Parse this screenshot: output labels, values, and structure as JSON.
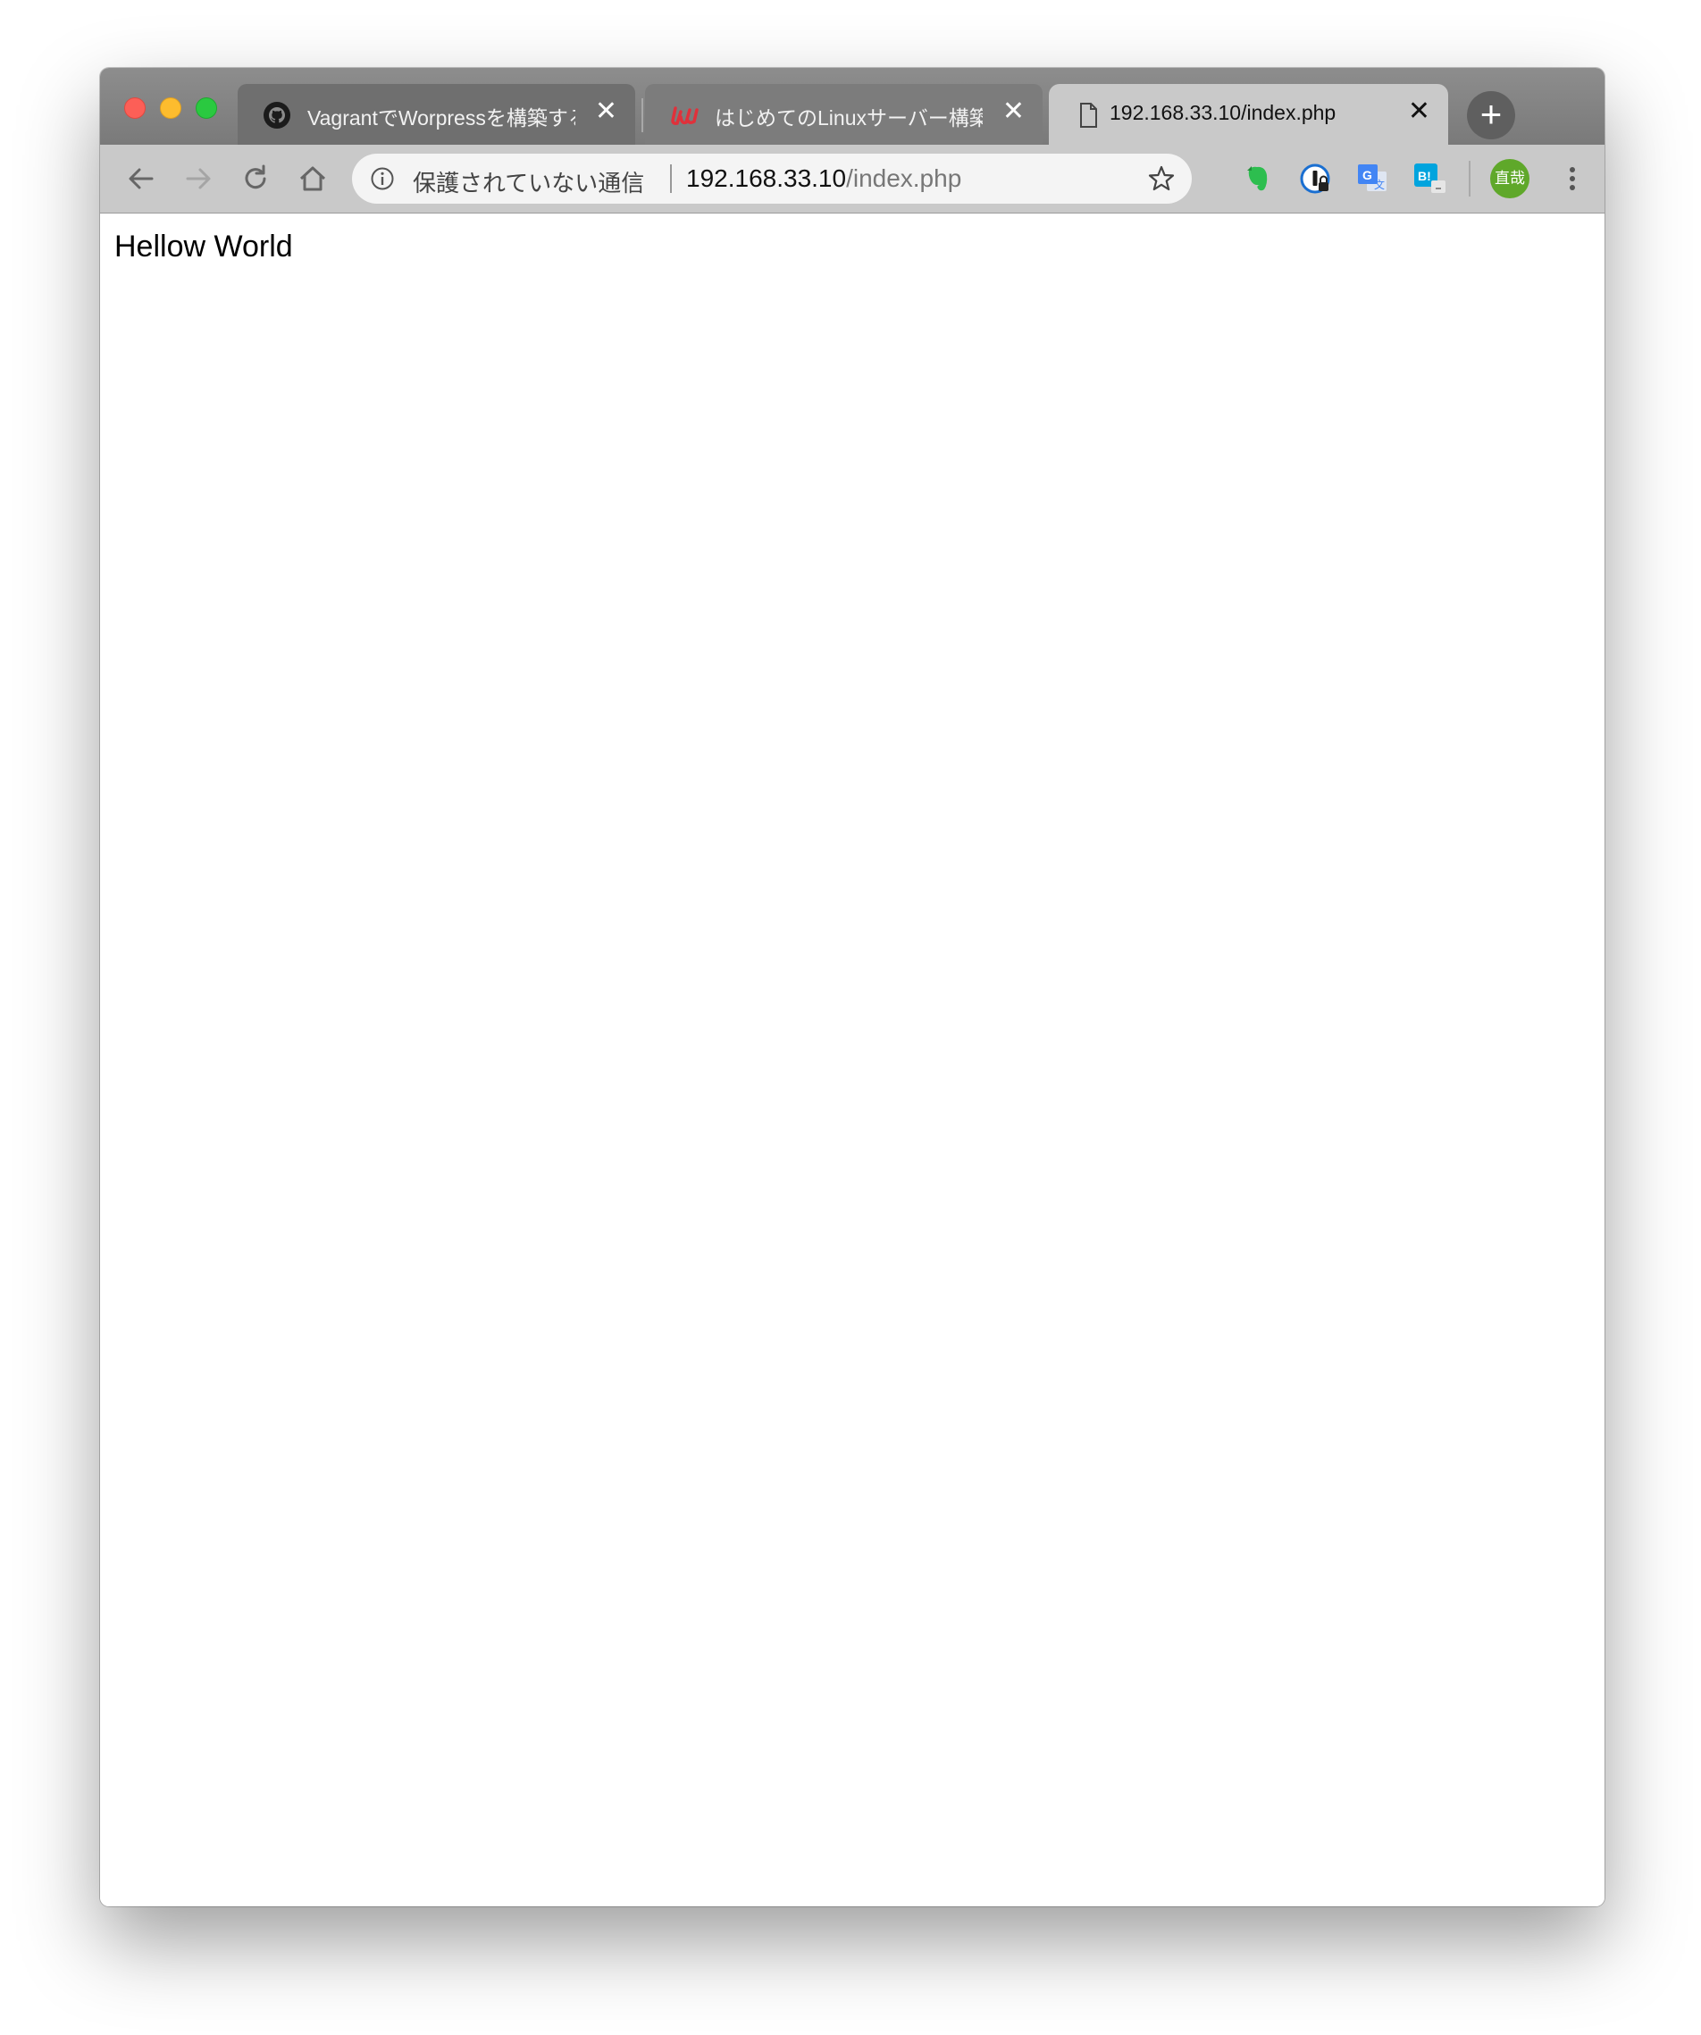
{
  "tabs": [
    {
      "title": "VagrantでWorpressを構築する",
      "icon": "github-icon",
      "close": "✕"
    },
    {
      "title": "はじめてのLinuxサーバー構築運用",
      "icon": "udemy-icon",
      "close": "✕"
    },
    {
      "title": "192.168.33.10/index.php",
      "icon": "document-icon",
      "close": "✕",
      "active": true
    }
  ],
  "new_tab": "+",
  "omnibox": {
    "security_label": "保護されていない通信",
    "url_host": "192.168.33.10",
    "url_path": "/index.php"
  },
  "profile": {
    "avatar_text": "直哉",
    "color": "#5fa82a"
  },
  "extensions": [
    "evernote-icon",
    "1password-icon",
    "google-translate-icon",
    "hatena-bookmark-icon"
  ],
  "page": {
    "body_text": "Hellow World"
  }
}
